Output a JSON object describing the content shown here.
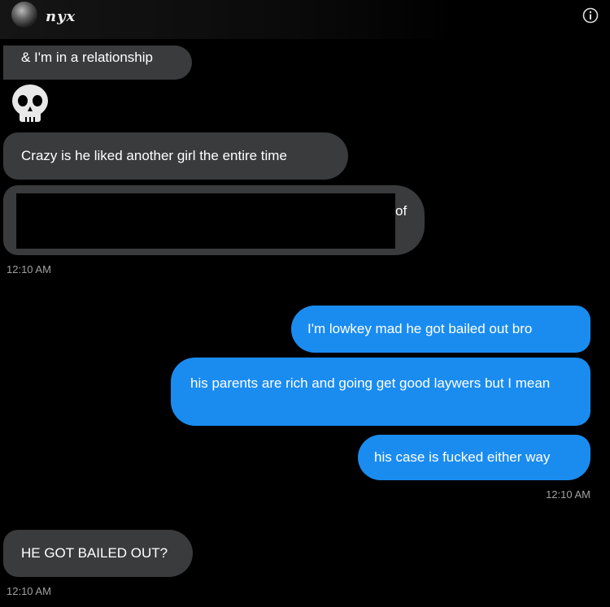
{
  "header": {
    "name": "nyx",
    "info_icon": "info-icon",
    "avatar_icon": "avatar"
  },
  "messages": {
    "in_1": "& I'm in a relationship",
    "emoji": "skull-emoji",
    "in_2": "Crazy is he liked another girl the entire time",
    "in_3_visible_tail": "of",
    "ts_1": "12:10 AM",
    "out_1": "I'm lowkey mad he got bailed out bro",
    "out_2": "his parents are rich and going get good laywers but I mean",
    "out_3": "his case is fucked either way",
    "ts_2": "12:10 AM",
    "in_4": "HE GOT BAILED OUT?",
    "ts_3": "12:10 AM"
  },
  "colors": {
    "incoming": "#3a3b3c",
    "outgoing": "#1a8cf0",
    "background": "#000000",
    "timestamp": "#a0a0a0"
  }
}
